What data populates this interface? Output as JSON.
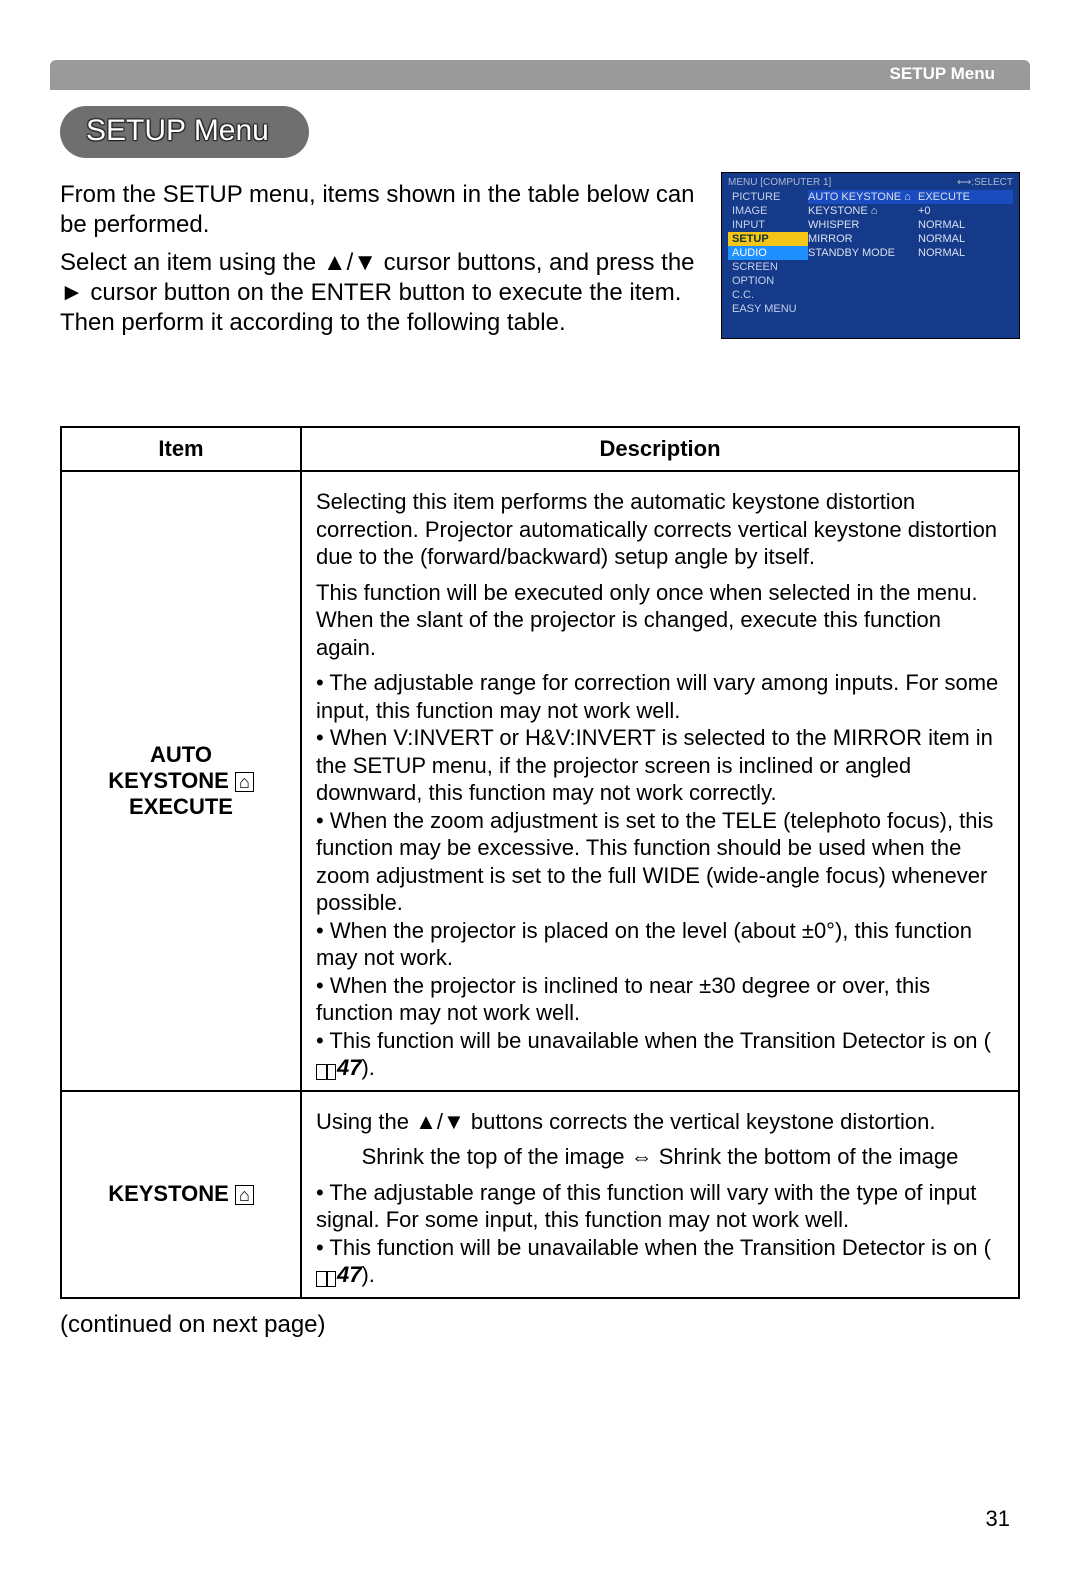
{
  "header": {
    "section_label": "SETUP Menu",
    "title": "SETUP Menu"
  },
  "intro": {
    "p1": "From the SETUP menu, items shown in the table below can be performed.",
    "p2_a": "Select an item using the ",
    "p2_b": " cursor buttons, and press the ",
    "p2_c": " cursor button on the ENTER button to execute the item. Then perform it according to the following table.",
    "arrows_ud": "▲/▼",
    "arrow_r": "►"
  },
  "menu_shot": {
    "header_left": "MENU [COMPUTER 1]",
    "header_right": "⟷:SELECT",
    "left_items": [
      "PICTURE",
      "IMAGE",
      "INPUT",
      "SETUP",
      "AUDIO",
      "SCREEN",
      "OPTION",
      "C.C.",
      "EASY MENU"
    ],
    "right_rows": [
      {
        "label": "AUTO KEYSTONE ⌂",
        "value": "EXECUTE"
      },
      {
        "label": "KEYSTONE ⌂",
        "value": "+0"
      },
      {
        "label": "WHISPER",
        "value": "NORMAL"
      },
      {
        "label": "MIRROR",
        "value": "NORMAL"
      },
      {
        "label": "STANDBY MODE",
        "value": "NORMAL"
      }
    ]
  },
  "table": {
    "head_item": "Item",
    "head_desc": "Description",
    "row1": {
      "item_l1": "AUTO",
      "item_l2_a": "KEYSTONE ",
      "item_l3": "EXECUTE",
      "keystone_sym": "⌂",
      "p1": "Selecting this item performs the automatic keystone distortion correction. Projector automatically corrects vertical keystone distortion due to the (forward/backward) setup angle by itself.",
      "p2": "This function will be executed only once when selected in the menu. When the slant of the projector is changed, execute this function again.",
      "b1": "• The adjustable range for correction will vary among inputs. For some input, this function may not work well.",
      "b2": "• When V:INVERT or H&V:INVERT is selected to the MIRROR item in the SETUP menu, if the projector screen is inclined or angled downward, this function may not work correctly.",
      "b3": "• When the zoom adjustment is set to the TELE (telephoto focus), this function may be excessive. This function should be used when the zoom adjustment is set to the full WIDE (wide-angle focus) whenever possible.",
      "b4": "• When the projector is placed on the level (about ±0°), this function may not work.",
      "b5": "• When the projector is inclined to near ±30 degree or over, this function may not work well.",
      "b6_a": "• This function will be unavailable when the Transition Detector is on (",
      "b6_ref": "47",
      "b6_b": ")."
    },
    "row2": {
      "item_a": "KEYSTONE ",
      "keystone_sym": "⌂",
      "p1_a": "Using the ",
      "p1_b": " buttons corrects the vertical keystone distortion.",
      "arrows_ud": "▲/▼",
      "p2": "Shrink the top of the image ⇔ Shrink the bottom of the image",
      "b1": "• The adjustable range of this function will vary with the type of input signal. For some input, this function may not work well.",
      "b2_a": "• This function will be unavailable when the Transition Detector is on (",
      "b2_ref": "47",
      "b2_b": ")."
    }
  },
  "continued": "(continued on next page)",
  "page_number": "31"
}
